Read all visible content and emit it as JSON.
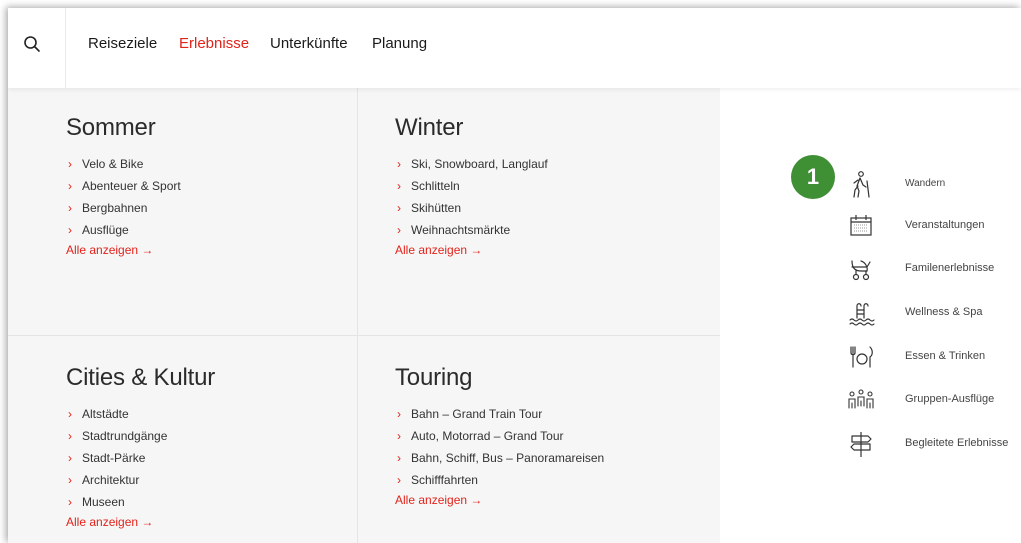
{
  "nav": {
    "search_icon": "search-icon",
    "items": [
      {
        "label": "Reiseziele",
        "active": false
      },
      {
        "label": "Erlebnisse",
        "active": true
      },
      {
        "label": "Unterkünfte",
        "active": false
      },
      {
        "label": "Planung",
        "active": false
      }
    ]
  },
  "sections": [
    {
      "title": "Sommer",
      "items": [
        "Velo & Bike",
        "Abenteuer & Sport",
        "Bergbahnen",
        "Ausflüge"
      ],
      "show_all": "Alle anzeigen →"
    },
    {
      "title": "Winter",
      "items": [
        "Ski, Snowboard, Langlauf",
        "Schlitteln",
        "Skihütten",
        "Weihnachtsmärkte"
      ],
      "show_all": "Alle anzeigen →"
    },
    {
      "title": "Cities & Kultur",
      "items": [
        "Altstädte",
        "Stadtrundgänge",
        "Stadt-Pärke",
        "Architektur",
        "Museen"
      ],
      "show_all": "Alle anzeigen →"
    },
    {
      "title": "Touring",
      "items": [
        "Bahn – Grand Train Tour",
        "Auto, Motorrad – Grand Tour",
        "Bahn, Schiff, Bus – Panoramareisen",
        "Schifffahrten"
      ],
      "show_all": "Alle anzeigen →"
    }
  ],
  "item_marker": "›",
  "badge": "1",
  "activities": [
    {
      "icon": "hiker-icon",
      "label": "Wandern"
    },
    {
      "icon": "calendar-icon",
      "label": "Veranstaltungen"
    },
    {
      "icon": "stroller-icon",
      "label": "Familenerlebnisse"
    },
    {
      "icon": "pool-ladder-icon",
      "label": "Wellness & Spa"
    },
    {
      "icon": "fork-plate-icon",
      "label": "Essen & Trinken"
    },
    {
      "icon": "group-icon",
      "label": "Gruppen-Ausflüge"
    },
    {
      "icon": "signpost-icon",
      "label": "Begleitete Erlebnisse"
    }
  ],
  "colors": {
    "accent": "#e2231a",
    "badge": "#3f8f35",
    "panel": "#f6f6f6"
  }
}
